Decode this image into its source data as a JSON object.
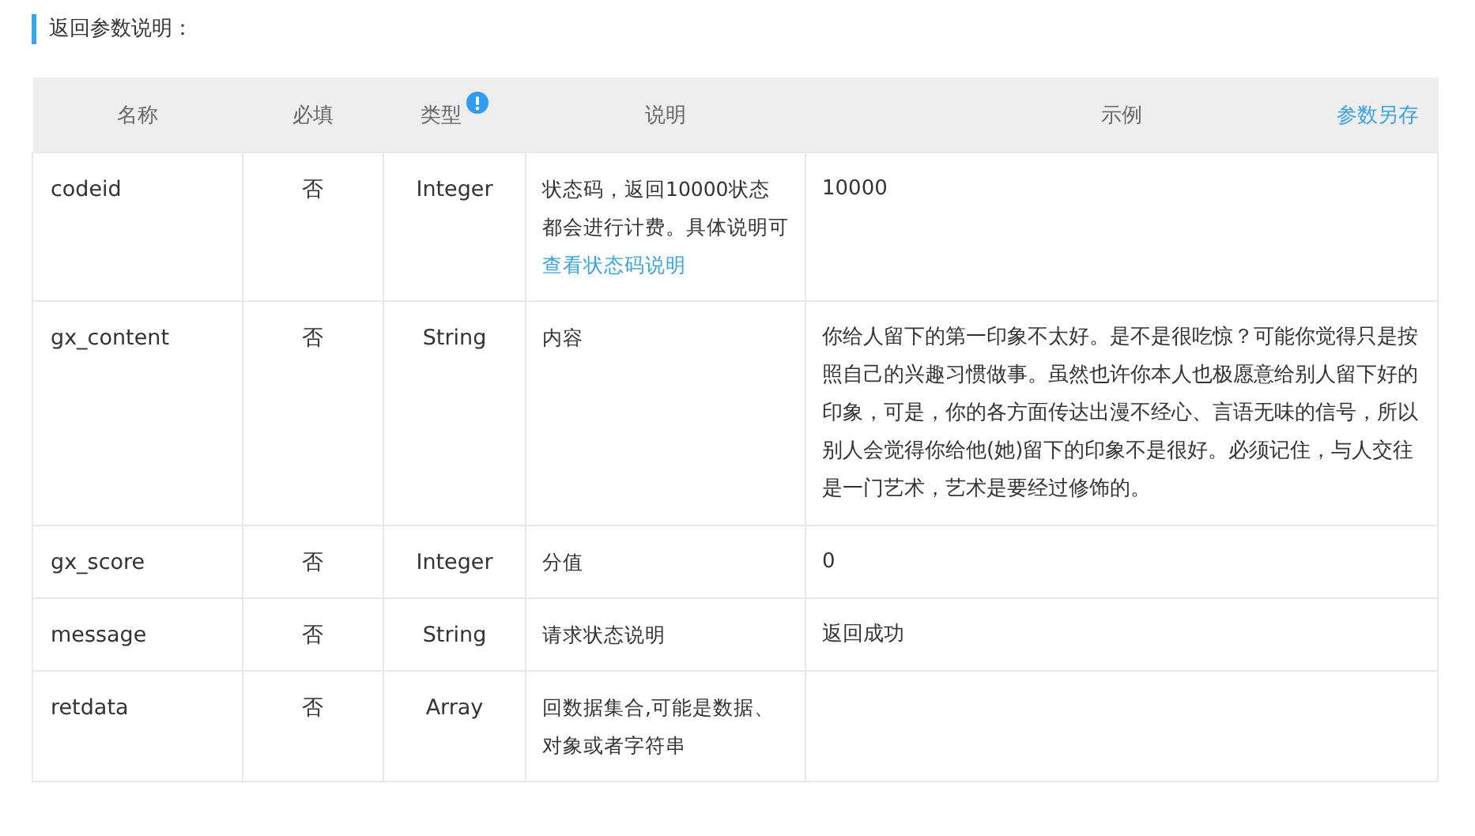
{
  "section_title": "返回参数说明：",
  "table": {
    "columns": [
      {
        "label": "名称",
        "kind": "plain"
      },
      {
        "label": "必填",
        "kind": "plain"
      },
      {
        "label": "类型",
        "kind": "info"
      },
      {
        "label": "说明",
        "kind": "plain"
      },
      {
        "label": "示例",
        "kind": "action",
        "action": "参数另存"
      }
    ],
    "rows": [
      {
        "name": "codeid",
        "required": "否",
        "type": "Integer",
        "description": "状态码，返回10000状态都会进行计费。具体说明可",
        "description_link": "查看状态码说明",
        "example": "10000"
      },
      {
        "name": "gx_content",
        "required": "否",
        "type": "String",
        "description": "内容",
        "example": "你给人留下的第一印象不太好。是不是很吃惊？可能你觉得只是按照自己的兴趣习惯做事。虽然也许你本人也极愿意给别人留下好的印象，可是，你的各方面传达出漫不经心、言语无味的信号，所以别人会觉得你给他(她)留下的印象不是很好。必须记住，与人交往是一门艺术，艺术是要经过修饰的。"
      },
      {
        "name": "gx_score",
        "required": "否",
        "type": "Integer",
        "description": "分值",
        "example": "0"
      },
      {
        "name": "message",
        "required": "否",
        "type": "String",
        "description": "请求状态说明",
        "example": "返回成功"
      },
      {
        "name": "retdata",
        "required": "否",
        "type": "Array",
        "description": "回数据集合,可能是数据、对象或者字符串"
      }
    ]
  }
}
